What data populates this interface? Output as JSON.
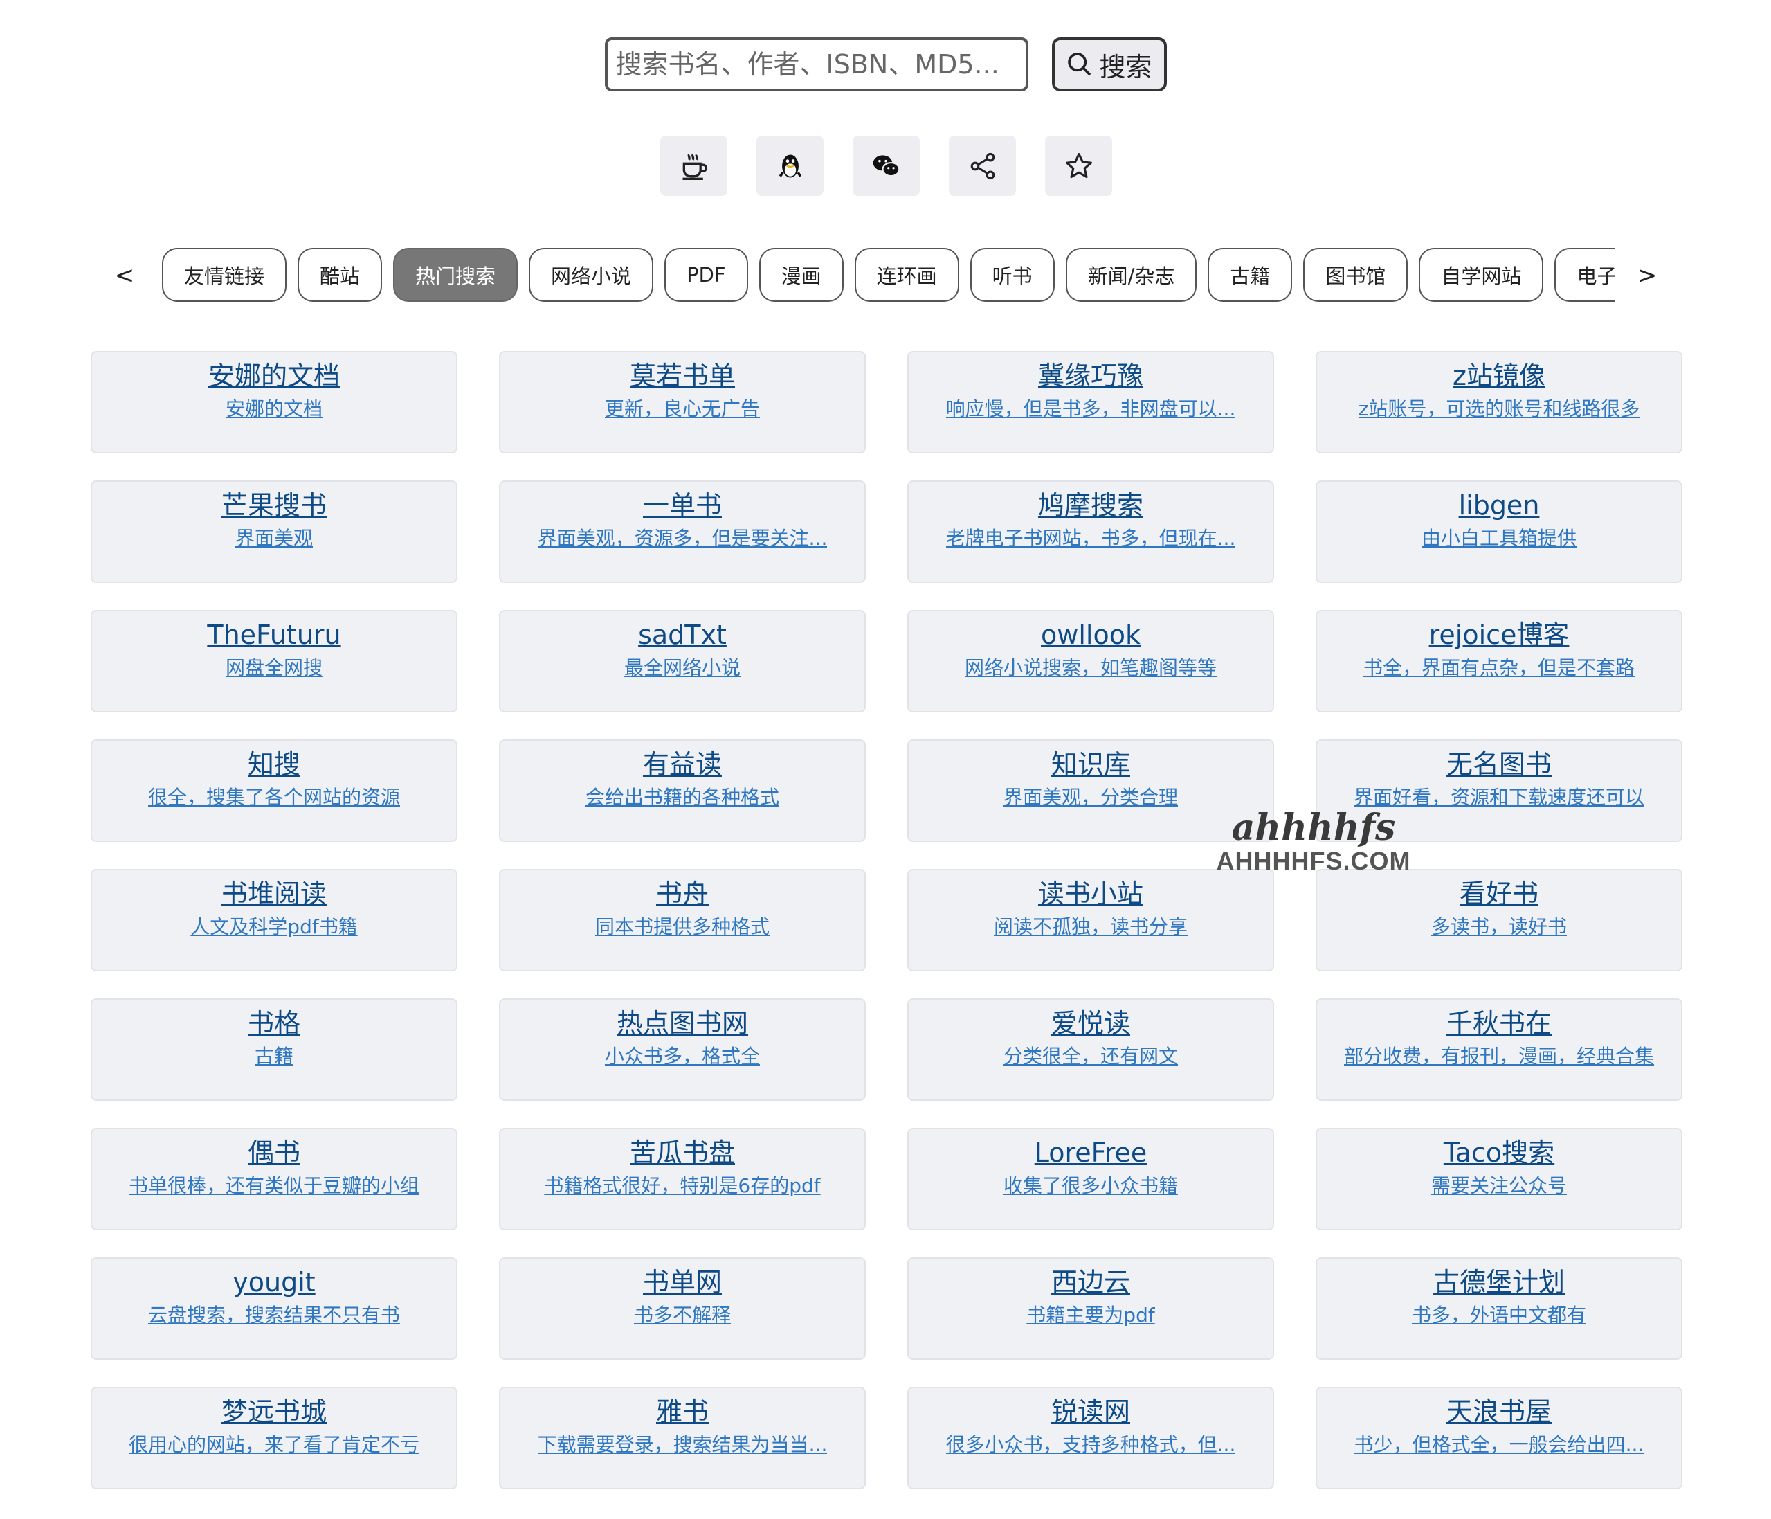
{
  "search": {
    "placeholder": "搜索书名、作者、ISBN、MD5...",
    "button_label": "搜索"
  },
  "icons": [
    "coffee-icon",
    "qq-penguin-icon",
    "wechat-icon",
    "share-icon",
    "star-icon"
  ],
  "tabs": {
    "prev": "<",
    "next": ">",
    "items": [
      "友情链接",
      "酷站",
      "热门搜索",
      "网络小说",
      "PDF",
      "漫画",
      "连环画",
      "听书",
      "新闻/杂志",
      "古籍",
      "图书馆",
      "自学网站",
      "电子书"
    ],
    "active_index": 2
  },
  "cards": [
    {
      "title": "安娜的文档",
      "desc": "安娜的文档"
    },
    {
      "title": "莫若书单",
      "desc": "更新，良心无广告"
    },
    {
      "title": "冀缘巧豫",
      "desc": "响应慢，但是书多，非网盘可以..."
    },
    {
      "title": "z站镜像",
      "desc": "z站账号，可选的账号和线路很多"
    },
    {
      "title": "芒果搜书",
      "desc": "界面美观"
    },
    {
      "title": "一单书",
      "desc": "界面美观，资源多，但是要关注..."
    },
    {
      "title": "鸠摩搜索",
      "desc": "老牌电子书网站，书多，但现在..."
    },
    {
      "title": "libgen",
      "desc": "由小白工具箱提供"
    },
    {
      "title": "TheFuturu",
      "desc": "网盘全网搜"
    },
    {
      "title": "sadTxt",
      "desc": "最全网络小说"
    },
    {
      "title": "owllook",
      "desc": "网络小说搜索，如笔趣阁等等"
    },
    {
      "title": "rejoice博客",
      "desc": "书全，界面有点杂，但是不套路"
    },
    {
      "title": "知搜",
      "desc": "很全，搜集了各个网站的资源"
    },
    {
      "title": "有益读",
      "desc": "会给出书籍的各种格式"
    },
    {
      "title": "知识库",
      "desc": "界面美观，分类合理"
    },
    {
      "title": "无名图书",
      "desc": "界面好看，资源和下载速度还可以"
    },
    {
      "title": "书堆阅读",
      "desc": "人文及科学pdf书籍"
    },
    {
      "title": "书舟",
      "desc": "同本书提供多种格式"
    },
    {
      "title": "读书小站",
      "desc": "阅读不孤独，读书分享"
    },
    {
      "title": "看好书",
      "desc": "多读书，读好书"
    },
    {
      "title": "书格",
      "desc": "古籍"
    },
    {
      "title": "热点图书网",
      "desc": "小众书多，格式全"
    },
    {
      "title": "爱悦读",
      "desc": "分类很全，还有网文"
    },
    {
      "title": "千秋书在",
      "desc": "部分收费，有报刊，漫画，经典合集"
    },
    {
      "title": "偶书",
      "desc": "书单很棒，还有类似于豆瓣的小组"
    },
    {
      "title": "苦瓜书盘",
      "desc": "书籍格式很好，特别是6存的pdf"
    },
    {
      "title": "LoreFree",
      "desc": "收集了很多小众书籍"
    },
    {
      "title": "Taco搜索",
      "desc": "需要关注公众号"
    },
    {
      "title": "yougit",
      "desc": "云盘搜索，搜索结果不只有书"
    },
    {
      "title": "书单网",
      "desc": "书多不解释"
    },
    {
      "title": "西边云",
      "desc": "书籍主要为pdf"
    },
    {
      "title": "古德堡计划",
      "desc": "书多，外语中文都有"
    },
    {
      "title": "梦远书城",
      "desc": "很用心的网站，来了看了肯定不亏"
    },
    {
      "title": "雅书",
      "desc": "下载需要登录，搜索结果为当当..."
    },
    {
      "title": "锐读网",
      "desc": "很多小众书，支持多种格式，但..."
    },
    {
      "title": "天浪书屋",
      "desc": "书少，但格式全，一般会给出四..."
    }
  ],
  "watermark": {
    "logo": "ahhhhfs",
    "text": "AHHHHFS.COM"
  }
}
